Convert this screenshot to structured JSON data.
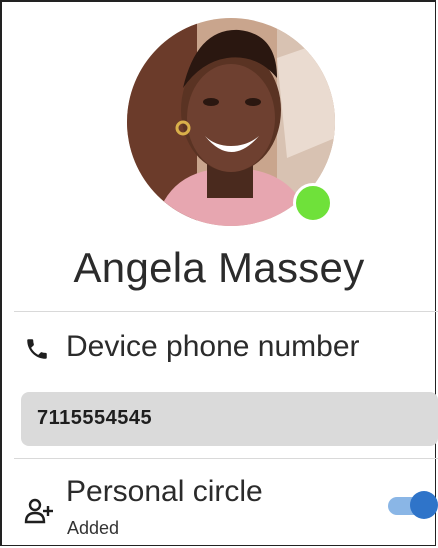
{
  "contact": {
    "name": "Angela Massey",
    "status": "online"
  },
  "phone": {
    "label": "Device phone number",
    "value": "7115554545",
    "icon": "phone-icon"
  },
  "circle": {
    "label": "Personal circle",
    "status": "Added",
    "icon": "add-person-icon",
    "toggle_on": true
  },
  "colors": {
    "presence": "#6fe13a",
    "toggle_knob": "#2f74c9",
    "toggle_track": "#8ab6e6",
    "phone_box_bg": "#dadada"
  }
}
